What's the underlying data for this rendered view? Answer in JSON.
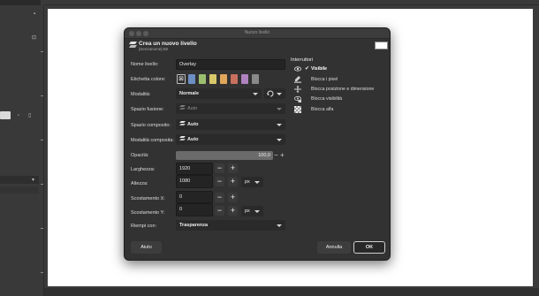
{
  "window": {
    "title": "Nuovo livello"
  },
  "header": {
    "title": "Crea un nuovo livello",
    "subtitle": "[Senzanome]-88"
  },
  "form": {
    "name_label": "Nome livello:",
    "name_value": "Overlay",
    "color_tag_label": "Etichetta colore:",
    "color_tags": [
      {
        "color": "#6c8fc4"
      },
      {
        "color": "#9bbf6e"
      },
      {
        "color": "#d8c86a"
      },
      {
        "color": "#e0a65a"
      },
      {
        "color": "#c9705f"
      },
      {
        "color": "#b082c0"
      },
      {
        "color": "#8a8a8a"
      }
    ],
    "mode_label": "Modalità:",
    "mode_value": "Normale",
    "blend_space_label": "Spazio fusione:",
    "blend_space_value": "Auto",
    "composite_space_label": "Spazio composito:",
    "composite_space_value": "Auto",
    "composite_mode_label": "Modalità composita:",
    "composite_mode_value": "Auto",
    "opacity_label": "Opacità:",
    "opacity_value": "100,0",
    "opacity_fraction": 1.0,
    "width_label": "Larghezza:",
    "width_value": "1920",
    "height_label": "Altezza:",
    "height_value": "1080",
    "offset_x_label": "Scostamento X:",
    "offset_x_value": "0",
    "offset_y_label": "Scostamento Y:",
    "offset_y_value": "0",
    "unit_value": "px",
    "fill_label": "Riempi con:",
    "fill_value": "Trasparenza",
    "minus_glyph": "−",
    "plus_glyph": "+"
  },
  "switches": {
    "title": "Interruttori",
    "items": [
      {
        "label": "Visibile",
        "checked": true,
        "icon": "eye-icon"
      },
      {
        "label": "Blocca i pixel",
        "checked": false,
        "icon": "brush-lock-icon"
      },
      {
        "label": "Blocca posizione e dimensione",
        "checked": false,
        "icon": "move-lock-icon"
      },
      {
        "label": "Blocca visibilità",
        "checked": false,
        "icon": "eye-lock-icon"
      },
      {
        "label": "Blocca alfa",
        "checked": false,
        "icon": "alpha-checker-icon"
      }
    ],
    "check_glyph": "✔"
  },
  "buttons": {
    "help": "Aiuto",
    "cancel": "Annulla",
    "ok": "OK"
  },
  "colors": {
    "dialog_bg": "#323232",
    "field_bg": "#242424",
    "accent_border": "#cfcfcf"
  }
}
